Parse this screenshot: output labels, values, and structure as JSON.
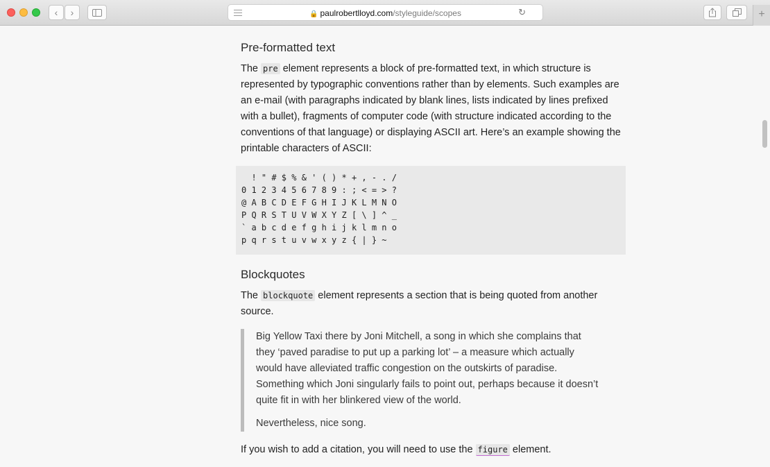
{
  "browser": {
    "url_domain": "paulrobertlloyd.com",
    "url_path": "/styleguide/scopes",
    "lock_icon": "lock-icon",
    "back_glyph": "‹",
    "forward_glyph": "›",
    "reload_glyph": "↻",
    "new_tab_glyph": "+"
  },
  "preformatted": {
    "heading": "Pre-formatted text",
    "intro_prefix": "The ",
    "intro_code": "pre",
    "intro_suffix": " element represents a block of pre-formatted text, in which structure is represented by typographic conventions rather than by elements. Such examples are an e-mail (with paragraphs indicated by blank lines, lists indicated by lines prefixed with a bullet), fragments of computer code (with structure indicated according to the conventions of that language) or displaying ASCII art. Here’s an example showing the printable characters of ASCII:",
    "ascii": "  ! \" # $ % & ' ( ) * + , - . /\n0 1 2 3 4 5 6 7 8 9 : ; < = > ?\n@ A B C D E F G H I J K L M N O\nP Q R S T U V W X Y Z [ \\ ] ^ _\n` a b c d e f g h i j k l m n o\np q r s t u v w x y z { | } ~"
  },
  "blockquotes": {
    "heading": "Blockquotes",
    "intro_prefix": "The ",
    "intro_code": "blockquote",
    "intro_suffix": " element represents a section that is being quoted from another source.",
    "quote_para1": "Big Yellow Taxi there by Joni Mitchell, a song in which she complains that they ‘paved paradise to put up a parking lot’ – a measure which actually would have alleviated traffic congestion on the outskirts of paradise. Something which Joni singularly fails to point out, perhaps because it doesn’t quite fit in with her blinkered view of the world.",
    "quote_para2": "Nevertheless, nice song.",
    "citation_prefix": "If you wish to add a citation, you will need to use the ",
    "citation_code": "figure",
    "citation_suffix": " element."
  },
  "colors": {
    "page_bg": "#f7f7f7",
    "code_bg": "#e6e6e6",
    "blockquote_border": "#bcbcbc",
    "link_underline": "#c36ad1"
  }
}
